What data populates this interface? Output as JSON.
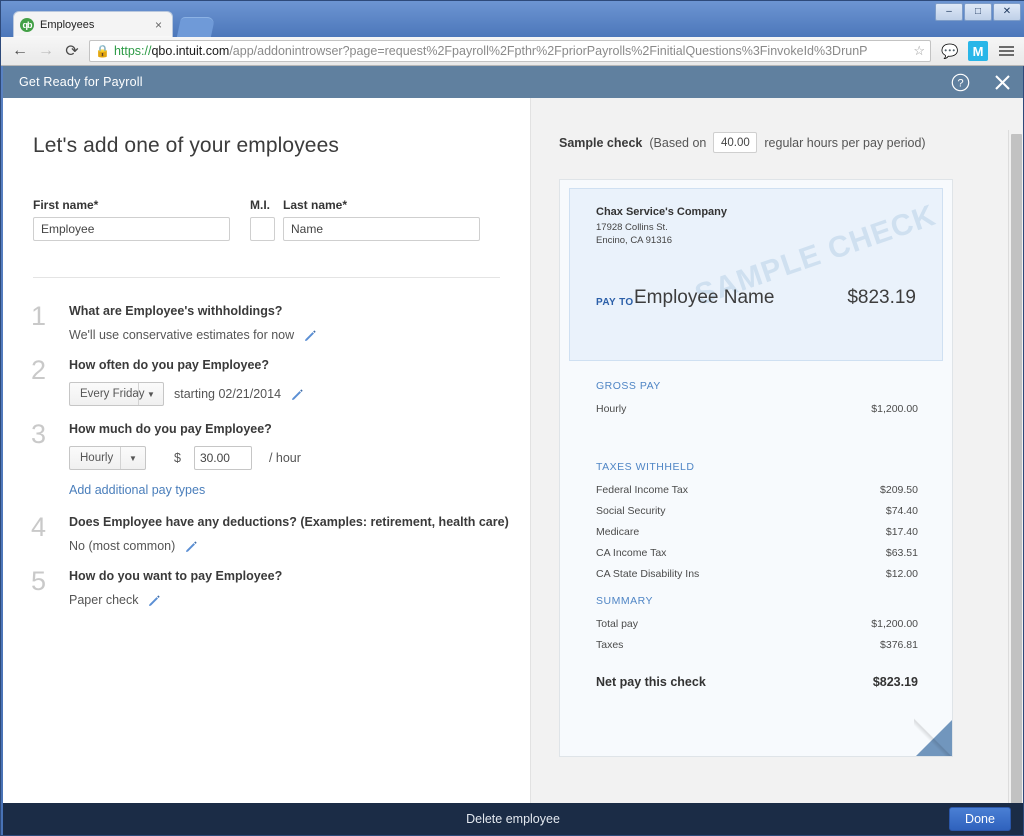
{
  "browser": {
    "tab": {
      "title": "Employees",
      "favicon": "qb-logo-icon",
      "close": "×"
    },
    "window_controls": {
      "minimize": "–",
      "maximize": "□",
      "close": "✕"
    },
    "nav": {
      "back": "←",
      "forward": "→",
      "reload": "⟳"
    },
    "url": {
      "scheme": "https://",
      "host": "qbo.intuit.com",
      "path": "/app/addonintrowser?page=request%2Fpayroll%2Fpthr%2FpriorPayrolls%2FinitialQuestions%3FinvokeId%3DrunP",
      "lock_icon": "lock-icon",
      "star_icon": "star-icon"
    },
    "toolbar_icons": {
      "comment": "☺",
      "extension": "M",
      "menu": "menu-icon"
    }
  },
  "app": {
    "header": {
      "title": "Get Ready for Payroll",
      "help": "?",
      "close": "✕"
    },
    "footer": {
      "delete_label": "Delete employee",
      "done_label": "Done"
    }
  },
  "form": {
    "page_title": "Let's add one of your employees",
    "first_name": {
      "label": "First name*",
      "value": "Employee"
    },
    "middle_initial": {
      "label": "M.I.",
      "value": ""
    },
    "last_name": {
      "label": "Last name*",
      "value": "Name"
    },
    "steps": [
      {
        "num": "1",
        "question": "What are Employee's withholdings?",
        "answer": "We'll use conservative estimates for now"
      },
      {
        "num": "2",
        "question": "How often do you pay Employee?",
        "frequency": "Every Friday",
        "starting": "starting 02/21/2014"
      },
      {
        "num": "3",
        "question": "How much do you pay Employee?",
        "pay_type": "Hourly",
        "currency": "$",
        "rate": "30.00",
        "unit": "/ hour",
        "add_link": "Add additional pay types"
      },
      {
        "num": "4",
        "question": "Does Employee have any deductions? (Examples: retirement, health care)",
        "answer": "No (most common)"
      },
      {
        "num": "5",
        "question": "How do you want to pay Employee?",
        "answer": "Paper check"
      }
    ]
  },
  "sample_check": {
    "heading": "Sample check",
    "based_on_prefix": "(Based on",
    "hours": "40.00",
    "based_on_suffix": "regular hours per pay period)",
    "watermark": "SAMPLE CHECK",
    "company": {
      "name": "Chax Service's Company",
      "address1": "17928 Collins St.",
      "address2": "Encino, CA 91316"
    },
    "pay_to_label": "PAY TO",
    "payee": "Employee Name",
    "amount": "$823.19",
    "gross_pay": {
      "title": "GROSS PAY",
      "rows": [
        {
          "label": "Hourly",
          "amount": "$1,200.00"
        }
      ]
    },
    "taxes_withheld": {
      "title": "TAXES WITHHELD",
      "rows": [
        {
          "label": "Federal Income Tax",
          "amount": "$209.50"
        },
        {
          "label": "Social Security",
          "amount": "$74.40"
        },
        {
          "label": "Medicare",
          "amount": "$17.40"
        },
        {
          "label": "CA Income Tax",
          "amount": "$63.51"
        },
        {
          "label": "CA State Disability Ins",
          "amount": "$12.00"
        }
      ]
    },
    "summary": {
      "title": "SUMMARY",
      "rows": [
        {
          "label": "Total pay",
          "amount": "$1,200.00"
        },
        {
          "label": "Taxes",
          "amount": "$376.81"
        }
      ]
    },
    "net_pay": {
      "label": "Net pay this check",
      "amount": "$823.19"
    }
  },
  "colors": {
    "app_header": "#60809f",
    "footer": "#1b2c46",
    "accent_blue": "#4a7ebb",
    "check_blue": "#2b5fa8",
    "done_button": "#2f62bd"
  }
}
